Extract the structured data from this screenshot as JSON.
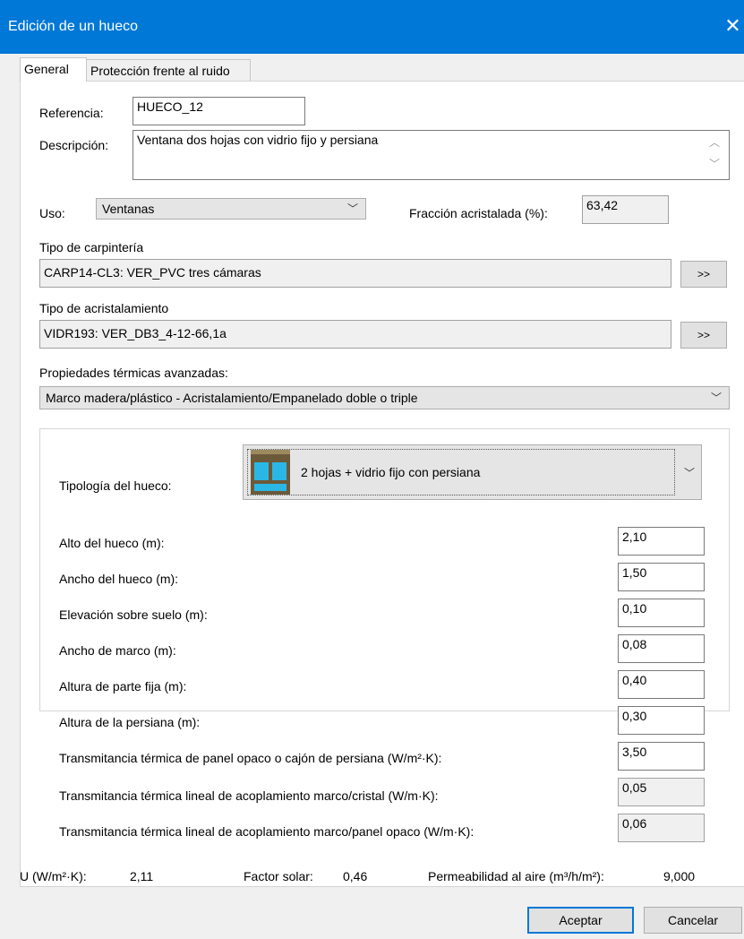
{
  "window": {
    "title": "Edición de un hueco"
  },
  "tabs": [
    {
      "label": "General"
    },
    {
      "label": "Protección frente al ruido"
    }
  ],
  "general": {
    "referencia_label": "Referencia:",
    "referencia_value": "HUECO_12",
    "descripcion_label": "Descripción:",
    "descripcion_value": "Ventana dos hojas con vidrio fijo y persiana",
    "uso_label": "Uso:",
    "uso_value": "Ventanas",
    "fraccion_label": "Fracción acristalada (%):",
    "fraccion_value": "63,42",
    "carpinteria_label": "Tipo de carpintería",
    "carpinteria_value": "CARP14-CL3: VER_PVC tres cámaras",
    "acristalamiento_label": "Tipo de acristalamiento",
    "acristalamiento_value": "VIDR193: VER_DB3_4-12-66,1a",
    "browse_label": ">>",
    "propiedades_label": "Propiedades térmicas avanzadas:",
    "propiedades_value": "Marco madera/plástico - Acristalamiento/Empanelado doble o triple"
  },
  "tipologia": {
    "label": "Tipología del hueco:",
    "value": "2 hojas + vidrio fijo con persiana",
    "icon": "window-two-leaves-shutter-icon"
  },
  "params": [
    {
      "label": "Alto del hueco (m):",
      "value": "2,10",
      "readonly": false
    },
    {
      "label": "Ancho del hueco (m):",
      "value": "1,50",
      "readonly": false
    },
    {
      "label": "Elevación sobre suelo (m):",
      "value": "0,10",
      "readonly": false
    },
    {
      "label": "Ancho de marco (m):",
      "value": "0,08",
      "readonly": false
    },
    {
      "label": "Altura de parte fija (m):",
      "value": "0,40",
      "readonly": false
    },
    {
      "label": "Altura de la persiana (m):",
      "value": "0,30",
      "readonly": false
    },
    {
      "label": "Transmitancia térmica de panel opaco o cajón de persiana (W/m²·K):",
      "value": "3,50",
      "readonly": false
    },
    {
      "label": "Transmitancia térmica lineal de acoplamiento marco/cristal (W/m·K):",
      "value": "0,05",
      "readonly": true
    },
    {
      "label": "Transmitancia térmica lineal de acoplamiento marco/panel opaco (W/m·K):",
      "value": "0,06",
      "readonly": true
    }
  ],
  "results": {
    "u_label": "U (W/m²·K):",
    "u_value": "2,11",
    "factor_label": "Factor solar:",
    "factor_value": "0,46",
    "permeabilidad_label": "Permeabilidad al aire (m³/h/m²):",
    "permeabilidad_value": "9,000"
  },
  "buttons": {
    "accept": "Aceptar",
    "cancel": "Cancelar"
  },
  "colors": {
    "titlebar": "#0078d7",
    "accent": "#0078d7",
    "window_icon_frame": "#6b5a3a",
    "window_icon_glass": "#2bb7e6"
  }
}
